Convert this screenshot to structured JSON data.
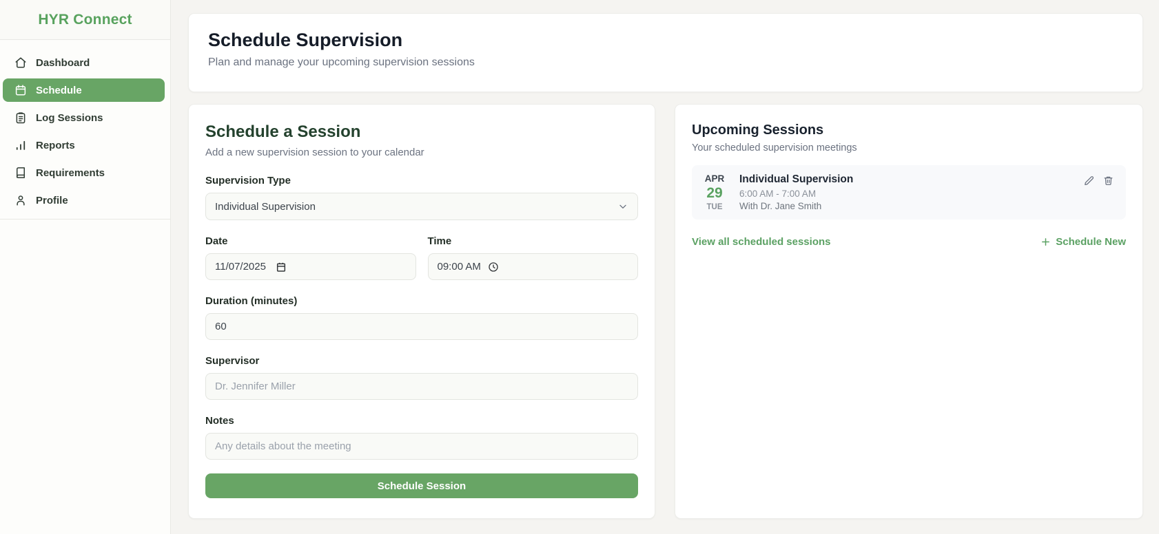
{
  "colors": {
    "accent_green": "#68a565",
    "brand_green": "#58a25e",
    "form_title_green": "#24422e",
    "page_bg": "#f5f4f1",
    "muted_gray": "#6b7280",
    "session_card_bg": "#f8f9fb"
  },
  "sidebar": {
    "brand": "HYR Connect",
    "items": [
      {
        "label": "Dashboard",
        "icon": "home-icon",
        "active": false
      },
      {
        "label": "Schedule",
        "icon": "calendar-icon",
        "active": true
      },
      {
        "label": "Log Sessions",
        "icon": "clipboard-icon",
        "active": false
      },
      {
        "label": "Reports",
        "icon": "bar-chart-icon",
        "active": false
      },
      {
        "label": "Requirements",
        "icon": "book-icon",
        "active": false
      },
      {
        "label": "Profile",
        "icon": "user-icon",
        "active": false
      }
    ]
  },
  "header": {
    "title": "Schedule Supervision",
    "subtitle": "Plan and manage your upcoming supervision sessions"
  },
  "form": {
    "title": "Schedule a Session",
    "subtitle": "Add a new supervision session to your calendar",
    "supervision_type": {
      "label": "Supervision Type",
      "value": "Individual Supervision"
    },
    "date": {
      "label": "Date",
      "value": "11/07/2025"
    },
    "time": {
      "label": "Time",
      "value": "09:00 AM"
    },
    "duration": {
      "label": "Duration (minutes)",
      "value": "60"
    },
    "supervisor": {
      "label": "Supervisor",
      "placeholder": "Dr. Jennifer Miller"
    },
    "notes": {
      "label": "Notes",
      "placeholder": "Any details about the meeting"
    },
    "submit_label": "Schedule Session"
  },
  "upcoming": {
    "title": "Upcoming Sessions",
    "subtitle": "Your scheduled supervision meetings",
    "sessions": [
      {
        "month": "APR",
        "day": "29",
        "weekday": "TUE",
        "title": "Individual Supervision",
        "time_range": "6:00 AM - 7:00 AM",
        "with_text": "With Dr. Jane Smith"
      }
    ],
    "view_all_label": "View all scheduled sessions",
    "schedule_new_label": "Schedule New"
  }
}
